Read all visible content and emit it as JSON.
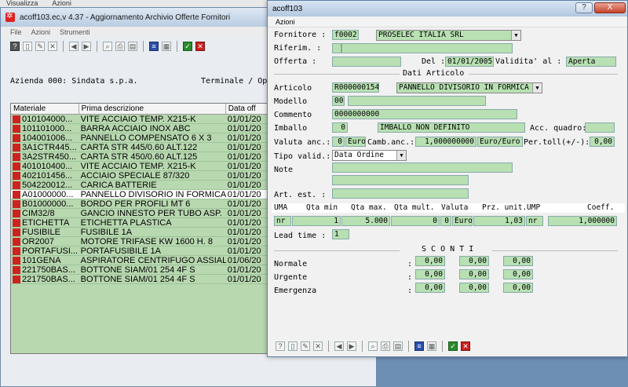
{
  "top_menu": [
    "Visualizza",
    "Azioni"
  ],
  "bg_window": {
    "title": "acoff103.ec,v 4.37 - Aggiornamento Archivio Offerte Fornitori",
    "menu": [
      "File",
      "Azioni",
      "Strumenti"
    ],
    "azienda": "Azienda 000: Sindata s.p.a.",
    "terminale": "Terminale / Ope",
    "columns": [
      "Materiale",
      "Prima descrizione",
      "Data off"
    ],
    "rows": [
      [
        "010104000...",
        "VITE ACCIAIO TEMP. X215-K",
        "01/01/20"
      ],
      [
        "101101000...",
        "BARRA ACCIAIO INOX ABC",
        "01/01/20"
      ],
      [
        "104001006...",
        "PANNELLO COMPENSATO 6 X 3",
        "01/01/20"
      ],
      [
        "3A1CTR445...",
        "CARTA STR 445/0.60 ALT.122",
        "01/01/20"
      ],
      [
        "3A2STR450...",
        "CARTA STR 450/0.60 ALT.125",
        "01/01/20"
      ],
      [
        "401010400...",
        "VITE ACCIAIO TEMP. X215-K",
        "01/01/20"
      ],
      [
        "402101456...",
        "ACCIAIO SPECIALE 87/320",
        "01/01/20"
      ],
      [
        "504220012...",
        "CARICA BATTERIE",
        "01/01/20"
      ],
      [
        "A01000000...",
        "PANNELLO DIVISORIO IN FORMICA",
        "01/01/20"
      ],
      [
        "B01000000...",
        "BORDO PER PROFILI MT 6",
        "01/01/20"
      ],
      [
        "CIM32/8",
        "GANCIO INNESTO PER TUBO ASP.",
        "01/01/20"
      ],
      [
        "ETICHETTA",
        "ETICHETTA PLASTICA",
        "01/01/20"
      ],
      [
        "FUSIBILE",
        "FUSIBILE 1A",
        "01/01/20"
      ],
      [
        "OR2007",
        "MOTORE TRIFASE KW 1600 H. 8",
        "01/01/20"
      ],
      [
        "PORTAFUSI...",
        "PORTAFUSIBILE 1A",
        "01/01/20"
      ],
      [
        "101GENA",
        "ASPIRATORE CENTRIFUGO ASSIALE",
        "01/06/20"
      ],
      [
        "221750BAS...",
        "BOTTONE SIAM/01 254 4F S",
        "01/01/20"
      ],
      [
        "221750BAS...",
        "BOTTONE SIAM/01 254 4F S",
        "01/01/20"
      ]
    ]
  },
  "dialog": {
    "title": "acoff103",
    "help": "?",
    "close": "X",
    "menu": "Azioni",
    "labels": {
      "fornitore": "Fornitore :",
      "riferim": "Riferim.  :",
      "offerta": "Offerta   :",
      "del": "Del :",
      "validita": "Validita' al   :",
      "dati_articolo": "Dati Articolo",
      "articolo": "Articolo",
      "modello": "Modello",
      "commento": "Commento",
      "imballo": "Imballo",
      "acc_quadro": "Acc. quadro:",
      "valuta_anc": "Valuta anc.:",
      "camb_anc": "Camb.anc.:",
      "per_toll": "Per.toll(+/-):",
      "tipo_valid": "Tipo valid.:",
      "note": "Note",
      "art_est": "Art. est. :",
      "uma": "UMA",
      "qta_min": "Qta min",
      "qta_max": "Qta max.",
      "qta_mult": "Qta mult.",
      "valuta": "Valuta",
      "prz_unit": "Prz. unit.",
      "ump": "UMP",
      "coeff": "Coeff.",
      "lead_time": "Lead time :",
      "sconti": "S C O N T I",
      "normale": "Normale",
      "urgente": "Urgente",
      "emergenza": "Emergenza",
      "colon": ":"
    },
    "values": {
      "fornitore_code": "f0002",
      "fornitore_name": "PROSELEC ITALIA SRL",
      "del_date": "01/01/2005",
      "validita_value": "Aperta",
      "articolo_code": "R000000154",
      "articolo_desc": "PANNELLO DIVISORIO IN FORMICA",
      "modello_code": "00",
      "commento": "0000000000",
      "imballo_code": "0",
      "imballo_desc": "IMBALLO NON DEFINITO",
      "valuta_num": "0",
      "valuta_cur": "Euro",
      "camb_value": "1,000000000",
      "camb_unit": "Euro/Euro",
      "per_toll": "0,00",
      "tipo_valid": "Data Ordine",
      "uma": "nr",
      "qta_min": "1",
      "qta_max": "5.000",
      "qta_mult": "0",
      "valuta": "0",
      "valuta_cur2": "Euro",
      "prz_unit": "1,03",
      "ump": "nr",
      "coeff": "1,000000",
      "lead_time": "1",
      "sconto": "0,00"
    }
  }
}
